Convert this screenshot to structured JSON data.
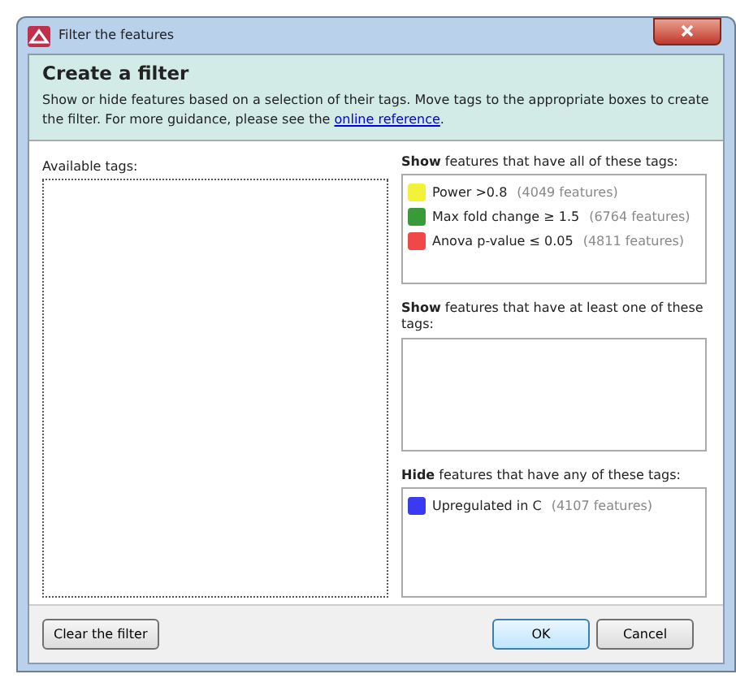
{
  "window": {
    "title": "Filter the features"
  },
  "header": {
    "title": "Create a filter",
    "description": "Show or hide features based on a selection of their tags. Move tags to the appropriate boxes to create the filter. For more guidance, please see the ",
    "link": "online reference",
    "after_link": "."
  },
  "available": {
    "label": "Available tags:"
  },
  "groups": [
    {
      "label": "**Show** features that have all of these tags:",
      "tags": [
        {
          "name": "Power >0.8",
          "count": "(4049 features)",
          "color": "#f2f23a"
        },
        {
          "name": "Max fold change ≥ 1.5",
          "count": "(6764 features)",
          "color": "#3a9a3a"
        },
        {
          "name": "Anova p-value ≤ 0.05",
          "count": "(4811 features)",
          "color": "#f04848"
        }
      ]
    },
    {
      "label": "**Show** features that have at least one of these tags:"
    },
    {
      "label": "**Hide** features that have any of these tags:",
      "tags": [
        {
          "name": "Upregulated in C",
          "count": "(4107 features)",
          "color": "#3a3af0"
        }
      ]
    }
  ],
  "buttons": {
    "clear": "Clear the filter",
    "ok": "OK",
    "cancel": "Cancel"
  }
}
